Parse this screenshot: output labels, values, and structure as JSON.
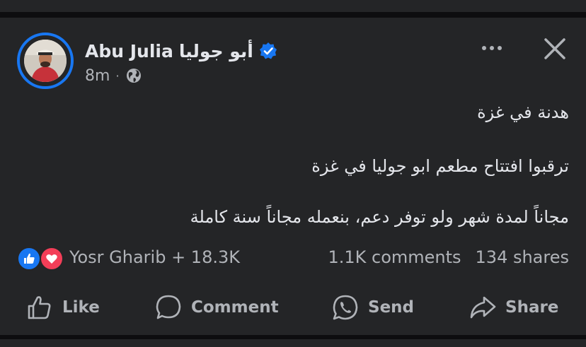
{
  "post": {
    "author": {
      "name_latin": "Abu Julia",
      "name_arabic": "أبو جوليا",
      "verified": true,
      "time": "8m",
      "dot": "·",
      "audience_icon": "globe-icon"
    },
    "body": {
      "line1": "هدنة في غزة",
      "line2": "ترقبوا افتتاح مطعم ابو جوليا في غزة",
      "line3": "مجاناً لمدة شهر ولو توفر دعم، بنعمله مجاناً سنة كاملة"
    },
    "stats": {
      "reaction_icons": [
        "like-reaction-icon",
        "love-reaction-icon"
      ],
      "reactions_text": "Yosr Gharib + 18.3K",
      "comments": "1.1K comments",
      "shares": "134 shares"
    },
    "actions": {
      "like": "Like",
      "comment": "Comment",
      "send": "Send",
      "share": "Share"
    },
    "colors": {
      "background": "#242527",
      "accent": "#1877f2",
      "love": "#f33e58",
      "text_primary": "#e4e6eb",
      "text_secondary": "#b0b3b8"
    }
  }
}
